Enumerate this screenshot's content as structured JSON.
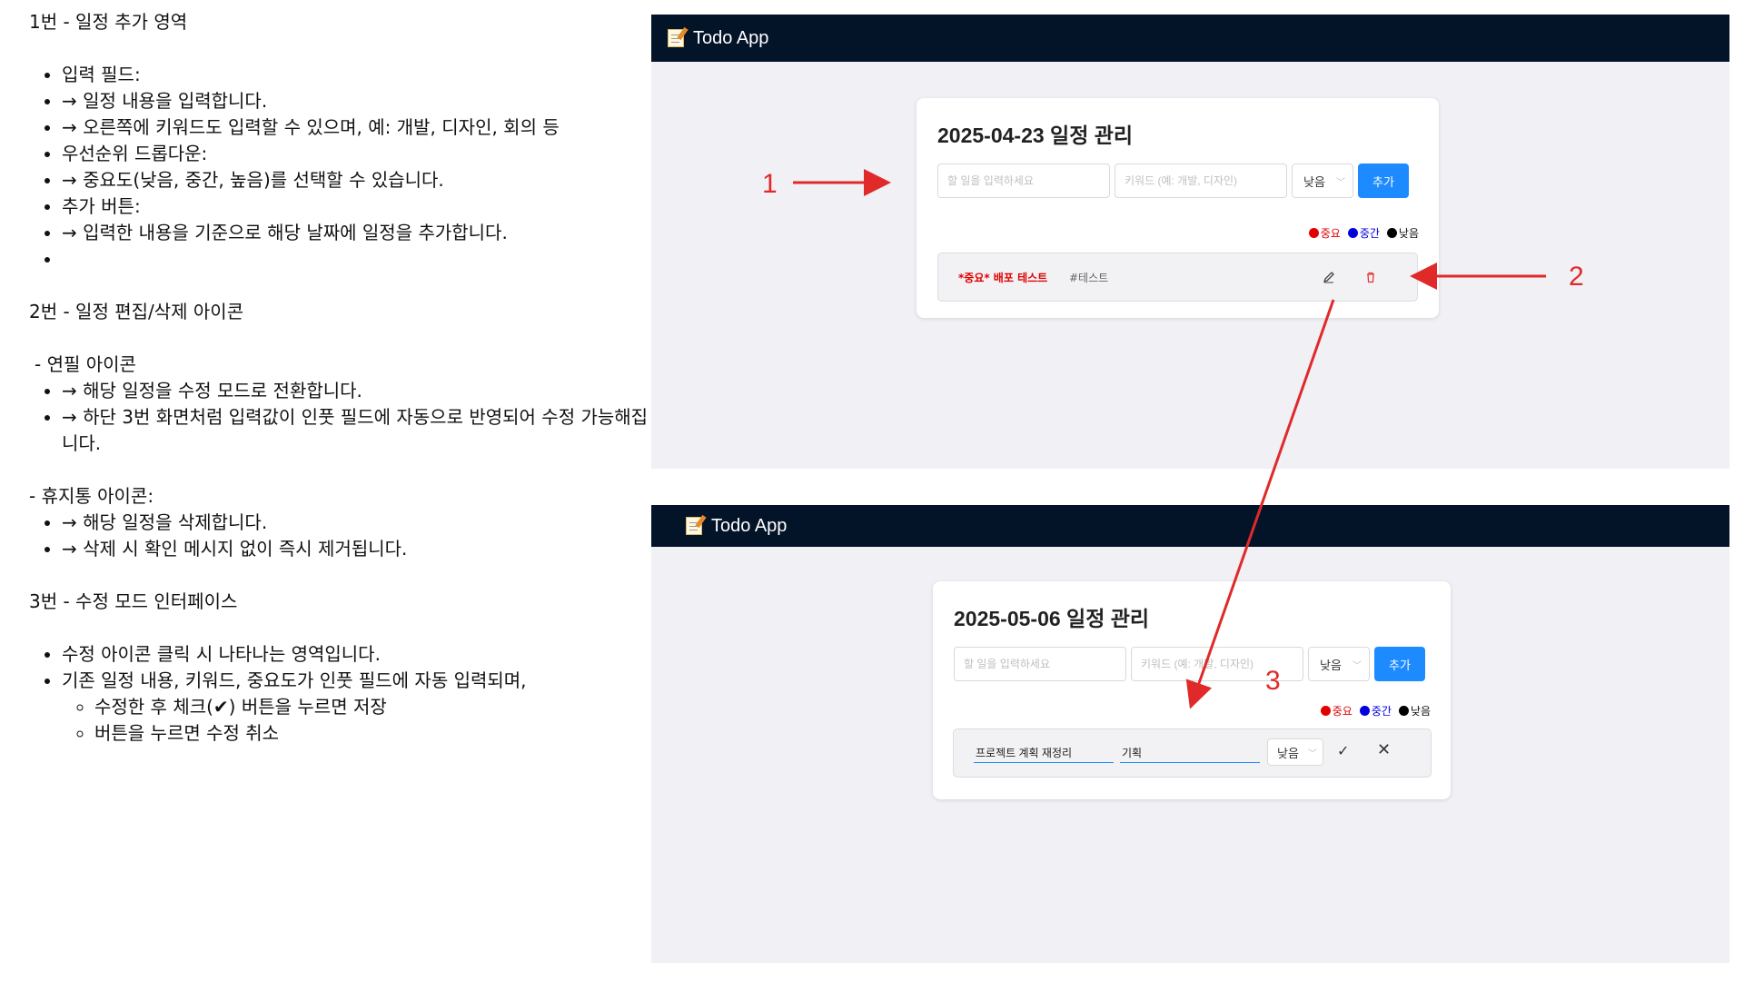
{
  "notes": {
    "s1_title": "1번 - 일정 추가 영역",
    "s1_items": [
      "입력 필드:",
      "→ 일정 내용을 입력합니다.",
      "→ 오른쪽에 키워드도 입력할 수 있으며, 예: 개발, 디자인, 회의 등",
      "우선순위 드롭다운:",
      "→ 중요도(낮음, 중간, 높음)를 선택할 수 있습니다.",
      "추가 버튼:",
      "→ 입력한 내용을 기준으로 해당 날짜에 일정을 추가합니다.",
      ""
    ],
    "s2_title": "2번 - 일정 편집/삭제 아이콘",
    "s2_pencil": "- 연필 아이콘",
    "s2_pencil_items": [
      "→ 해당 일정을 수정 모드로 전환합니다.",
      "→ 하단 3번 화면처럼 입력값이 인풋 필드에 자동으로 반영되어 수정 가능해집니다."
    ],
    "s2_trash": "- 휴지통 아이콘:",
    "s2_trash_items": [
      "→ 해당 일정을 삭제합니다.",
      "→ 삭제 시 확인 메시지 없이 즉시 제거됩니다."
    ],
    "s3_title": "3번 - 수정 모드 인터페이스",
    "s3_items": [
      "수정 아이콘 클릭 시 나타나는 영역입니다.",
      "기존 일정 내용, 키워드, 중요도가 인풋 필드에 자동 입력되며,"
    ],
    "s3_subitems": [
      "수정한 후 체크(✔) 버튼을 누르면 저장",
      "버튼을 누르면 수정 취소"
    ]
  },
  "app": {
    "title": "Todo App"
  },
  "screen1": {
    "heading": "2025-04-23 일정 관리",
    "todo_placeholder": "할 일을 입력하세요",
    "keyword_placeholder": "키워드 (예: 개발, 디자인)",
    "priority": "낮음",
    "add_label": "추가",
    "legend": [
      {
        "label": "중요",
        "color": "#e00000"
      },
      {
        "label": "중간",
        "color": "#0000dd"
      },
      {
        "label": "낮음",
        "color": "#000000"
      }
    ],
    "todo_text": "*중요* 배포 테스트",
    "todo_keyword": "#테스트"
  },
  "screen2": {
    "heading": "2025-05-06 일정 관리",
    "todo_placeholder": "할 일을 입력하세요",
    "keyword_placeholder": "키워드 (예: 개발, 디자인)",
    "priority": "낮음",
    "add_label": "추가",
    "legend": [
      {
        "label": "중요",
        "color": "#e00000"
      },
      {
        "label": "중간",
        "color": "#0000dd"
      },
      {
        "label": "낮음",
        "color": "#000000"
      }
    ],
    "edit_text": "프로젝트 계획 재정리",
    "edit_keyword": "기획",
    "edit_priority": "낮음"
  },
  "annotations": {
    "n1": "1",
    "n2": "2",
    "n3": "3",
    "color": "#e02a2a"
  }
}
